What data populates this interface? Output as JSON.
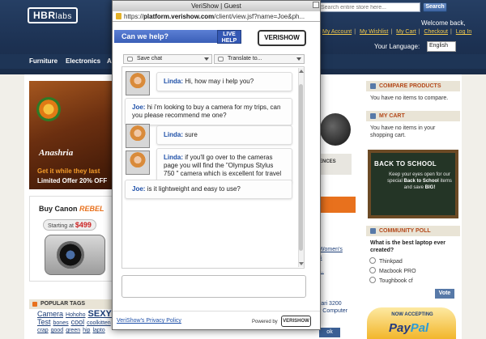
{
  "store": {
    "logo": "HBR",
    "logo_suffix": "labs",
    "search_placeholder": "Search entire store here...",
    "search_button": "Search",
    "welcome": "Welcome back,",
    "links": [
      "My Account",
      "My Wishlist",
      "My Cart",
      "Checkout",
      "Log In"
    ],
    "language_label": "Your Language:",
    "language_value": "English",
    "nav": [
      "Furniture",
      "Electronics",
      "A"
    ],
    "promo_name": "Anashria",
    "promo_tag": "Get it while they last",
    "promo_offer": "Limited Offer 20% OFF",
    "canon_title_prefix": "Buy Canon",
    "canon_title_brand": "REBEL",
    "canon_price_label": "Starting at",
    "canon_price": "$499",
    "tags_heading": "POPULAR TAGS",
    "tags": [
      "Camera",
      "Hohoho",
      "SEXY",
      "Te",
      "Test",
      "bones",
      "cool",
      "coolkitten",
      "crap",
      "good",
      "green",
      "hip",
      "lapto"
    ],
    "center_text": "ENCES",
    "center_links": [
      "Women's",
      "s",
      "...",
      "rari 3200",
      "r Computer"
    ],
    "center_button": "ok",
    "compare_heading": "COMPARE PRODUCTS",
    "compare_body": "You have no items to compare.",
    "cart_heading": "MY CART",
    "cart_body": "You have no items in your shopping cart.",
    "bts_title": "BACK TO SCHOOL",
    "bts_line1": "Keep your eyes open for our special",
    "bts_bold": "Back to School",
    "bts_line2": "items and save",
    "bts_big": "BIG!",
    "poll_heading": "COMMUNITY POLL",
    "poll_question": "What is the best laptop ever created?",
    "poll_options": [
      "Thinkpad",
      "Macbook PRO",
      "Toughbook cf"
    ],
    "vote_button": "Vote",
    "paypal_now": "NOW ACCEPTING",
    "paypal_a": "Pay",
    "paypal_b": "Pal"
  },
  "popup": {
    "title": "VeriShow | Guest",
    "url_prefix": "https://",
    "url_host": "platform.verishow.com",
    "url_path": "/client/view.jsf?name=Joe&ph...",
    "help_label": "Can we help?",
    "livehelp_line1": "LIVE",
    "livehelp_line2": "HELP",
    "brand_logo": "VERISHOW",
    "save_chat": "Save chat",
    "translate": "Translate to...",
    "privacy_link": "VeriShow's Privacy Policy",
    "powered_by": "Powered by",
    "powered_logo": "VERISHOW"
  },
  "messages": [
    {
      "sender": "Linda:",
      "text": "Hi, how may i help you?"
    },
    {
      "sender": "Joe:",
      "text": "hi i'm looking to buy a camera for my trips, can you please recommend me one?"
    },
    {
      "sender": "Linda:",
      "text": "sure"
    },
    {
      "sender": "Linda:",
      "text": "if you'll go over to the cameras page you will find the \"Olympus Stylus 750 \" camera which is excellent for travel"
    },
    {
      "sender": "Joe:",
      "text": "is it lightweight and easy to use?"
    }
  ]
}
